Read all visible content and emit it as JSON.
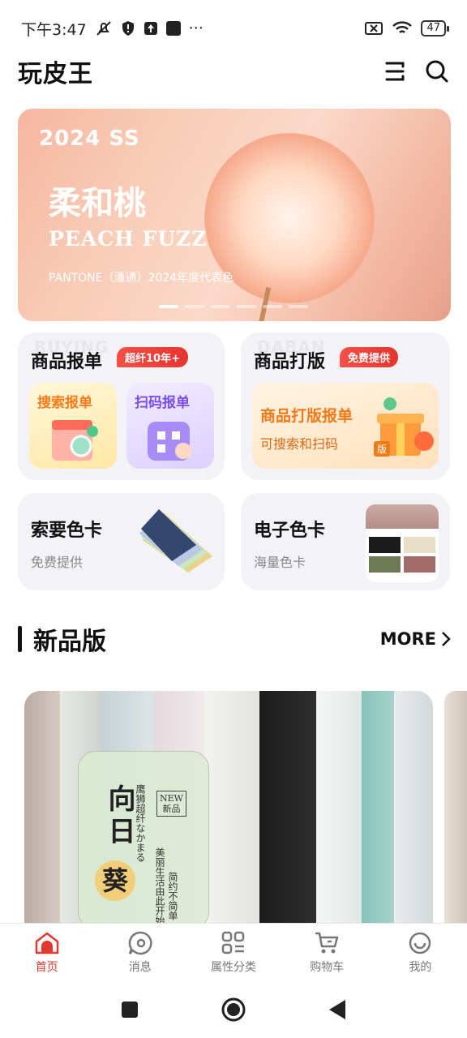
{
  "status_bar": {
    "time": "下午3:47",
    "more": "···",
    "battery": "47"
  },
  "header": {
    "brand": "玩皮王"
  },
  "banner": {
    "year": "2024 SS",
    "title": "柔和桃",
    "subtitle": "PEACH FUZZ",
    "note": "PANTONE（潘通）2024年度代表色",
    "slides": 6,
    "active_slide": 1
  },
  "cards": {
    "quote": {
      "ghost": "BUYING",
      "title": "商品报单",
      "badge": "超纤10年+",
      "tile_search": "搜索报单",
      "tile_scan": "扫码报单"
    },
    "sample": {
      "ghost": "DABAN",
      "title": "商品打版",
      "badge": "免费提供",
      "tile_title": "商品打版报单",
      "tile_sub": "可搜索和扫码",
      "tile_tag": "版"
    },
    "color_card": {
      "title": "索要色卡",
      "sub": "免费提供"
    },
    "e_color_card": {
      "title": "电子色卡",
      "sub": "海量色卡"
    }
  },
  "section": {
    "title": "新品版",
    "more": "MORE"
  },
  "product": {
    "big_text": "向日",
    "kui": "葵",
    "vert1": "鹰狮超纤なかまる",
    "new_en": "NEW",
    "new_cn": "新品",
    "vert2": "美丽生活由此开始",
    "vert3": "简约不简单"
  },
  "tabbar": {
    "tabs": [
      {
        "label": "首页",
        "icon": "home-icon"
      },
      {
        "label": "消息",
        "icon": "message-icon"
      },
      {
        "label": "属性分类",
        "icon": "category-icon"
      },
      {
        "label": "购物车",
        "icon": "cart-icon"
      },
      {
        "label": "我的",
        "icon": "profile-icon"
      }
    ],
    "active_index": 0
  },
  "colors": {
    "accent": "#e0392f",
    "banner": "#f6b6a0",
    "card_bg": "#f3f3f7"
  }
}
